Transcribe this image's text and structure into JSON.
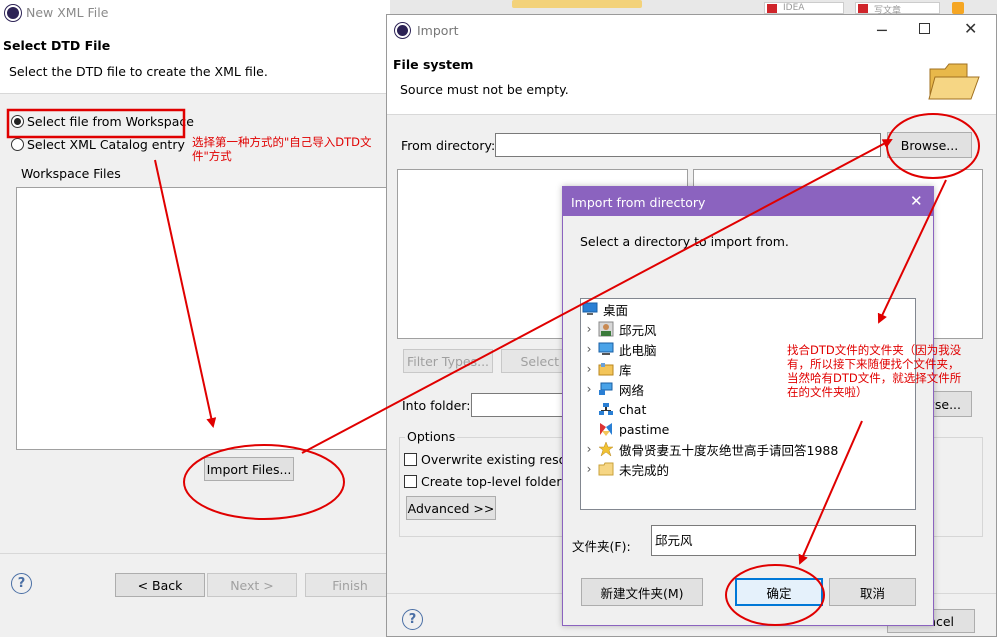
{
  "left_window": {
    "title": "New XML File",
    "heading": "Select DTD File",
    "description": "Select the DTD file to create the XML file.",
    "radio_workspace": "Select file from Workspace",
    "radio_catalog": "Select XML Catalog entry",
    "workspace_files_label": "Workspace Files",
    "import_files_button": "Import Files...",
    "back_button": "< Back",
    "next_button": "Next >",
    "finish_button": "Finish",
    "help_icon": "?"
  },
  "import_window": {
    "title": "Import",
    "heading": "File system",
    "message": "Source must not be empty.",
    "from_directory_label": "From directory:",
    "from_directory_value": "",
    "browse_button": "Browse...",
    "filter_types_button": "Filter Types...",
    "select_all_button": "Select A",
    "into_folder_label": "Into folder:",
    "into_browse_button": "owse...",
    "options_label": "Options",
    "overwrite_checkbox": "Overwrite existing resou",
    "create_folder_checkbox": "Create top-level folder",
    "advanced_button": "Advanced >>",
    "cancel_partial": "ncel",
    "help_icon": "?"
  },
  "dir_dialog": {
    "title": "Import from directory",
    "instruction": "Select a directory to import from.",
    "tree": [
      {
        "label": "桌面",
        "icon": "desktop-icon",
        "expandable": false,
        "indent": 0
      },
      {
        "label": "邱元风",
        "icon": "user-icon",
        "expandable": true,
        "indent": 1
      },
      {
        "label": "此电脑",
        "icon": "computer-icon",
        "expandable": true,
        "indent": 1
      },
      {
        "label": "库",
        "icon": "library-icon",
        "expandable": true,
        "indent": 1
      },
      {
        "label": "网络",
        "icon": "network-icon",
        "expandable": true,
        "indent": 1
      },
      {
        "label": "chat",
        "icon": "network-folder-icon",
        "expandable": false,
        "indent": 1
      },
      {
        "label": "pastime",
        "icon": "pastime-folder-icon",
        "expandable": false,
        "indent": 1
      },
      {
        "label": "傲骨贤妻五十度灰绝世高手请回答1988",
        "icon": "star-folder-icon",
        "expandable": true,
        "indent": 1
      },
      {
        "label": "未完成的",
        "icon": "folder-icon",
        "expandable": true,
        "indent": 1
      }
    ],
    "folder_label": "文件夹(F):",
    "folder_value": "邱元风",
    "new_folder_button": "新建文件夹(M)",
    "ok_button": "确定",
    "cancel_button": "取消"
  },
  "annotations": {
    "note1": "选择第一种方式的\"自己导入DTD文件\"方式",
    "note2": "找合DTD文件的文件夹（因为我没有，所以接下来随便找个文件夹，当然哈有DTD文件，就选择文件所在的文件夹啦）"
  },
  "taskbar": {
    "item1": "IDEA",
    "item2": "写文章"
  },
  "colors": {
    "dialog_titlebar": "#8b63bf",
    "annotation_red": "#e00000",
    "ok_border": "#0078d7"
  }
}
